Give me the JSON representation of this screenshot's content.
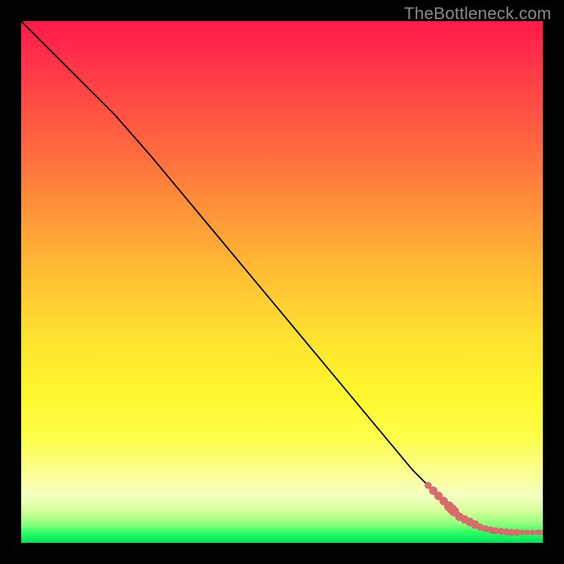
{
  "watermark": "TheBottleneck.com",
  "chart_data": {
    "type": "line",
    "title": "",
    "xlabel": "",
    "ylabel": "",
    "xlim": [
      0,
      100
    ],
    "ylim": [
      0,
      100
    ],
    "grid": false,
    "note": "Axes are unlabeled; values are estimated as percentages of the plot area. The black curve descends from top-left, with a slight knee around x≈25, then runs nearly straight to the lower-right where it flattens along y≈2. Salmon dots cluster along the lower-right segment of the curve and along the bottom edge.",
    "series": [
      {
        "name": "curve",
        "kind": "line",
        "x": [
          0,
          10,
          18,
          25,
          35,
          45,
          55,
          65,
          75,
          82,
          86,
          90,
          94,
          100
        ],
        "y": [
          100,
          90,
          82,
          74,
          62,
          50,
          38,
          26,
          14,
          7,
          4,
          2,
          2,
          2
        ]
      },
      {
        "name": "points",
        "kind": "scatter",
        "x": [
          78,
          79,
          80,
          81,
          82,
          82.5,
          83,
          84,
          85,
          86,
          87,
          88,
          89,
          90,
          91,
          92,
          93,
          94,
          95,
          96,
          97,
          98,
          99,
          99.5
        ],
        "y": [
          11,
          10,
          9,
          8,
          7,
          6.5,
          6,
          5,
          4.5,
          4,
          3.5,
          3,
          2.7,
          2.5,
          2.3,
          2.2,
          2.1,
          2,
          2,
          2,
          2,
          2,
          2,
          2
        ],
        "r": [
          5,
          6,
          6,
          6,
          7,
          7,
          7,
          6,
          6,
          6,
          6,
          5,
          5,
          5,
          5,
          5,
          5,
          5,
          5,
          4,
          4,
          4,
          4,
          4
        ]
      }
    ]
  }
}
